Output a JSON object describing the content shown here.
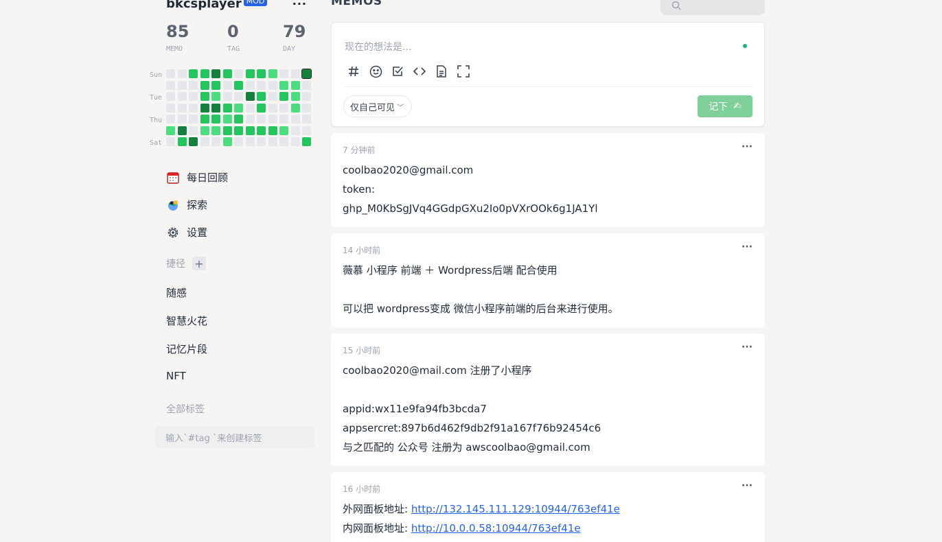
{
  "user": {
    "name": "bkcsplayer",
    "badge": "MOD"
  },
  "stats": [
    {
      "value": "85",
      "label": "MEMO"
    },
    {
      "value": "0",
      "label": "TAG"
    },
    {
      "value": "79",
      "label": "DAY"
    }
  ],
  "heatmap": {
    "day_labels": [
      "Sun",
      "Tue",
      "Thu",
      "Sat"
    ],
    "colors": {
      "0": "#e5e7eb",
      "1": "#4ade80",
      "2": "#22c55e",
      "3": "#15803d"
    },
    "weeks": [
      [
        0,
        0,
        0,
        0,
        0,
        1,
        0
      ],
      [
        0,
        0,
        0,
        0,
        0,
        3,
        2
      ],
      [
        2,
        0,
        0,
        0,
        0,
        0,
        3
      ],
      [
        2,
        2,
        2,
        3,
        2,
        1,
        0
      ],
      [
        3,
        2,
        1,
        3,
        2,
        1,
        0
      ],
      [
        2,
        0,
        0,
        2,
        1,
        2,
        1
      ],
      [
        0,
        2,
        0,
        1,
        2,
        2,
        0
      ],
      [
        2,
        0,
        3,
        0,
        0,
        2,
        0
      ],
      [
        2,
        0,
        2,
        2,
        0,
        2,
        0
      ],
      [
        1,
        0,
        0,
        0,
        0,
        2,
        0
      ],
      [
        0,
        1,
        2,
        0,
        0,
        1,
        0
      ],
      [
        0,
        1,
        1,
        1,
        0,
        0,
        0
      ],
      [
        3,
        0,
        0,
        0,
        0,
        0,
        2
      ]
    ]
  },
  "nav": [
    {
      "icon": "calendar-icon",
      "label": "每日回顾"
    },
    {
      "icon": "explore-icon",
      "label": "探索"
    },
    {
      "icon": "gear-icon",
      "label": "设置"
    }
  ],
  "shortcuts": {
    "title": "捷径",
    "items": [
      "随感",
      "智慧火花",
      "记忆片段",
      "NFT"
    ]
  },
  "tags": {
    "title": "全部标签",
    "hint": "输入`#tag `来创建标签"
  },
  "header": {
    "title": "MEMOS"
  },
  "editor": {
    "placeholder": "现在的想法是...",
    "visibility": "仅自己可见",
    "save_label": "记下",
    "save_icon": "✍"
  },
  "memos": [
    {
      "time": "7 分钟前",
      "lines": [
        "coolbao2020@gmail.com",
        "token:",
        "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"
      ]
    },
    {
      "time": "14 小时前",
      "lines": [
        "薇慕 小程序 前端 ＋ Wordpress后端 配合使用",
        "",
        "可以把 wordpress变成 微信小程序前端的后台来进行使用。"
      ]
    },
    {
      "time": "15 小时前",
      "lines": [
        "coolbao2020@mail.com 注册了小程序",
        "",
        "appid:wx11e9fa94fb3bcda7",
        "appsercret:897b6d462f9db2f91a167f76b92454c6",
        "与之匹配的 公众号 注册为 awscoolbao@gmail.com"
      ]
    },
    {
      "time": "16 小时前",
      "links": [
        {
          "label": "外网面板地址: ",
          "url": "http://132.145.111.129:10944/763ef41e"
        },
        {
          "label": "内网面板地址: ",
          "url": "http://10.0.0.58:10944/763ef41e"
        }
      ]
    }
  ]
}
